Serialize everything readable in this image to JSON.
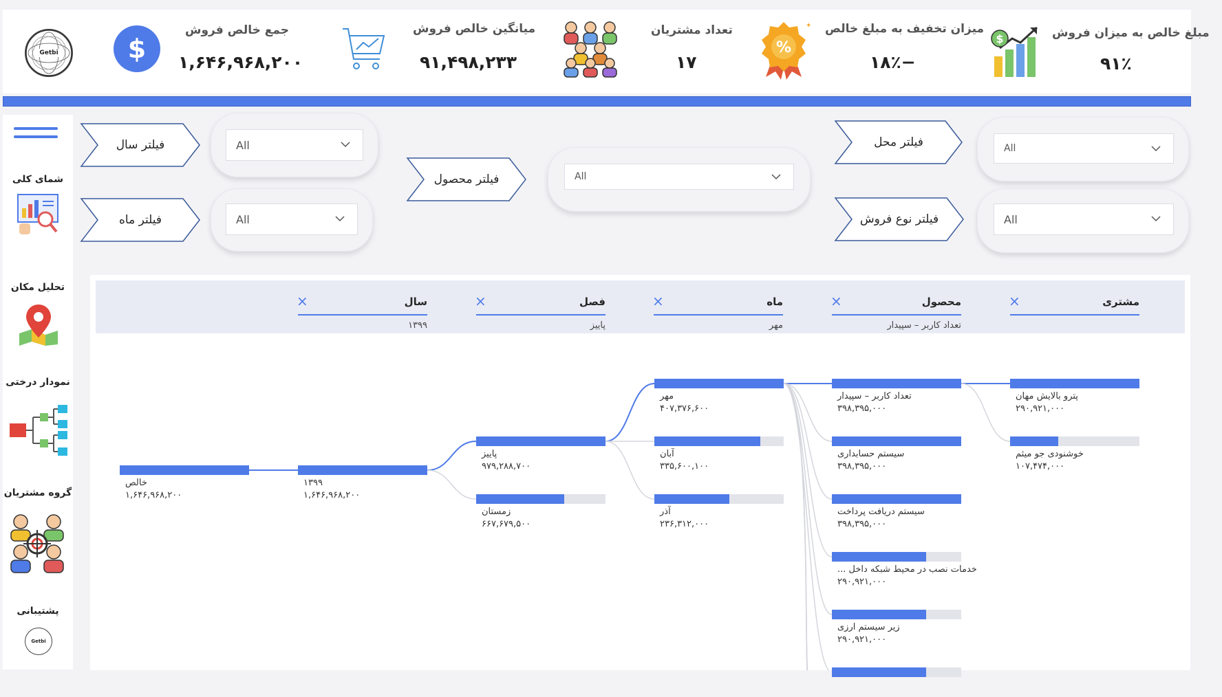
{
  "kpis": {
    "net_sales_ratio": {
      "title": "مبلغ خالص به میزان فروش",
      "value": "۹۱٪"
    },
    "discount_ratio": {
      "title": "میزان تخفیف به مبلغ خالص",
      "value": "−۱۸٪"
    },
    "customers": {
      "title": "تعداد مشتریان",
      "value": "۱۷"
    },
    "avg_net_sales": {
      "title": "میانگین خالص فروش",
      "value": "۹۱,۴۹۸,۲۳۳"
    },
    "total_net_sales": {
      "title": "جمع خالص فروش",
      "value": "۱,۶۴۶,۹۶۸,۲۰۰"
    }
  },
  "logo_text": "Getbi",
  "sidebar": {
    "items": [
      {
        "label": "شمای کلی",
        "icon": "dashboard-analysis-icon"
      },
      {
        "label": "تحلیل مکان",
        "icon": "map-pin-icon"
      },
      {
        "label": "نمودار درختی",
        "icon": "tree-diagram-icon"
      },
      {
        "label": "گروه مشتریان",
        "icon": "customer-group-icon"
      },
      {
        "label": "پشتیبانی",
        "icon": "getbi-logo-icon"
      }
    ],
    "logo_text": "Getbi"
  },
  "filters": {
    "year": {
      "label": "فیلتر سال",
      "value": "All"
    },
    "month": {
      "label": "فیلتر ماه",
      "value": "All"
    },
    "product": {
      "label": "فیلتر محصول",
      "value": "All"
    },
    "location": {
      "label": "فیلتر محل",
      "value": "All"
    },
    "sale_type": {
      "label": "فیلتر نوع فروش",
      "value": "All"
    }
  },
  "tree": {
    "levels": [
      {
        "title": "سال",
        "selected": "۱۳۹۹"
      },
      {
        "title": "فصل",
        "selected": "پاییز"
      },
      {
        "title": "ماه",
        "selected": "مهر"
      },
      {
        "title": "محصول",
        "selected": "تعداد کاربر – سپیدار"
      },
      {
        "title": "مشتری",
        "selected": ""
      }
    ],
    "root": {
      "label": "خالص",
      "value": "۱,۶۴۶,۹۶۸,۲۰۰",
      "fraction": 1.0
    },
    "year_nodes": [
      {
        "label": "۱۳۹۹",
        "value": "۱,۶۴۶,۹۶۸,۲۰۰",
        "fraction": 1.0
      }
    ],
    "season_nodes": [
      {
        "label": "پاییز",
        "value": "۹۷۹,۲۸۸,۷۰۰",
        "fraction": 1.0
      },
      {
        "label": "زمستان",
        "value": "۶۶۷,۶۷۹,۵۰۰",
        "fraction": 0.68
      }
    ],
    "month_nodes": [
      {
        "label": "مهر",
        "value": "۴۰۷,۳۷۶,۶۰۰",
        "fraction": 1.0
      },
      {
        "label": "آبان",
        "value": "۳۳۵,۶۰۰,۱۰۰",
        "fraction": 0.82
      },
      {
        "label": "آذر",
        "value": "۲۳۶,۳۱۲,۰۰۰",
        "fraction": 0.58
      }
    ],
    "product_nodes": [
      {
        "label": "تعداد کاربر – سپیدار",
        "value": "۳۹۸,۳۹۵,۰۰۰",
        "fraction": 1.0
      },
      {
        "label": "سیستم حسابداری",
        "value": "۳۹۸,۳۹۵,۰۰۰",
        "fraction": 1.0
      },
      {
        "label": "سیستم دریافت پرداخت",
        "value": "۳۹۸,۳۹۵,۰۰۰",
        "fraction": 1.0
      },
      {
        "label": "خدمات نصب در محیط شبکه داخل ...",
        "value": "۲۹۰,۹۲۱,۰۰۰",
        "fraction": 0.73
      },
      {
        "label": "زیر سیستم ارزی",
        "value": "۲۹۰,۹۲۱,۰۰۰",
        "fraction": 0.73
      },
      {
        "label": "",
        "value": "",
        "fraction": 0.73
      }
    ],
    "customer_nodes": [
      {
        "label": "پترو بالایش مهان",
        "value": "۲۹۰,۹۲۱,۰۰۰",
        "fraction": 1.0
      },
      {
        "label": "خوشنودی جو میثم",
        "value": "۱۰۷,۴۷۴,۰۰۰",
        "fraction": 0.37
      }
    ]
  },
  "colors": {
    "accent": "#4f7be8",
    "track": "#e3e4e9",
    "background": "#f3f3f6"
  }
}
